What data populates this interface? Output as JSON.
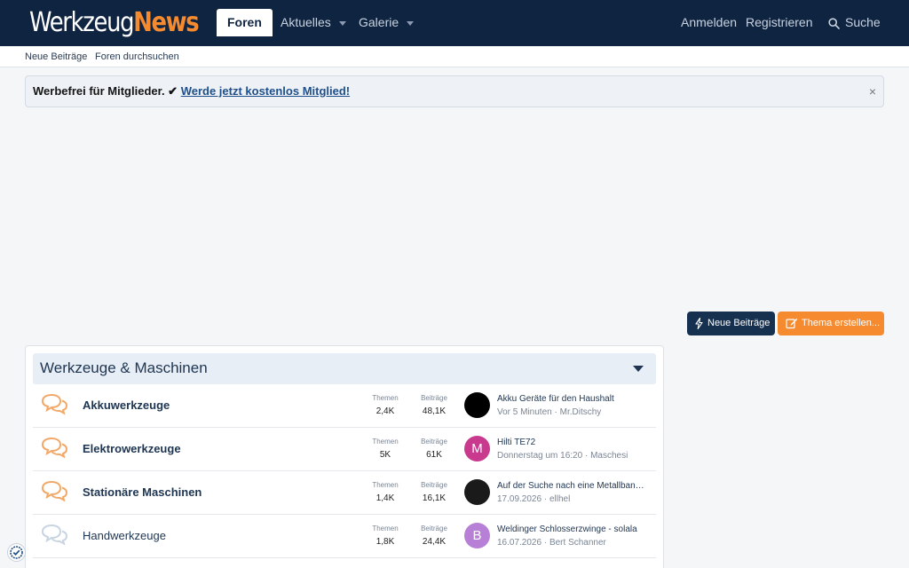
{
  "header": {
    "logo_part1": "Werkzeug",
    "logo_part2": "News",
    "nav": [
      {
        "label": "Foren",
        "active": true
      },
      {
        "label": "Aktuelles"
      },
      {
        "label": "Galerie"
      }
    ],
    "login": "Anmelden",
    "register": "Registrieren",
    "search": "Suche"
  },
  "subnav": [
    "Neue Beiträge",
    "Foren durchsuchen"
  ],
  "notice": {
    "text": "Werbefrei für Mitglieder. ✔ ",
    "link": "Werde jetzt kostenlos Mitglied!",
    "close": "×"
  },
  "buttons": {
    "new_posts": "Neue Beiträge",
    "create_thread": "Thema erstellen..."
  },
  "category": {
    "title": "Werkzeuge & Maschinen",
    "stat_labels": {
      "threads": "Themen",
      "posts": "Beiträge"
    },
    "forums": [
      {
        "name": "Akkuwerkzeuge",
        "threads": "2,4K",
        "posts": "48,1K",
        "last_title": "Akku Geräte für den Haushalt",
        "last_time": "Vor 5 Minuten",
        "last_user": "Mr.Ditschy",
        "avatar_letter": "",
        "avatar_color": "#000000",
        "unread": true
      },
      {
        "name": "Elektrowerkzeuge",
        "threads": "5K",
        "posts": "61K",
        "last_title": "Hilti TE72",
        "last_time": "Donnerstag um 16:20",
        "last_user": "Maschesi",
        "avatar_letter": "M",
        "avatar_color": "#c93a8e",
        "unread": true
      },
      {
        "name": "Stationäre Maschinen",
        "threads": "1,4K",
        "posts": "16,1K",
        "last_title": "Auf der Suche nach eine Metallbandsäge",
        "last_time": "17.09.2026",
        "last_user": "ellhel",
        "avatar_letter": "",
        "avatar_color": "#1a1a1a",
        "unread": true
      },
      {
        "name": "Handwerkzeuge",
        "threads": "1,8K",
        "posts": "24,4K",
        "last_title": "Weldinger Schlosserzwinge - solala",
        "last_time": "16.07.2026",
        "last_user": "Bert Schanner",
        "avatar_letter": "B",
        "avatar_color": "#b87fd6",
        "unread": false
      }
    ]
  },
  "colors": {
    "header_bg": "#0f2440",
    "accent": "#f58a2f",
    "link": "#1e3552"
  }
}
